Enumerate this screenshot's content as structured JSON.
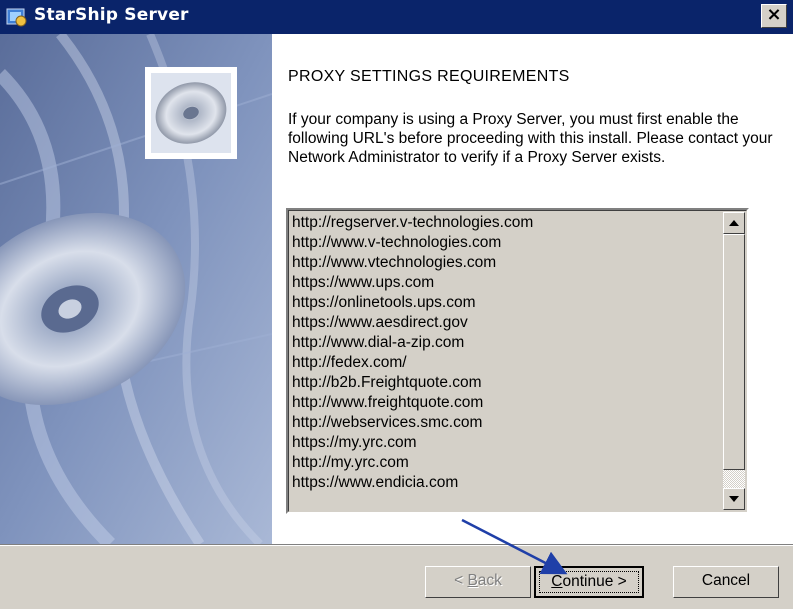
{
  "window": {
    "title": "StarShip Server",
    "close_glyph": "×",
    "icon": "starship-app-icon"
  },
  "content": {
    "heading": "PROXY SETTINGS REQUIREMENTS",
    "description": "If your company is using a Proxy Server, you must first enable the following URL's before proceeding with this install. Please contact your Network Administrator to verify if a Proxy Server exists.",
    "urls": [
      "http://regserver.v-technologies.com",
      "http://www.v-technologies.com",
      "http://www.vtechnologies.com",
      "https://www.ups.com",
      "https://onlinetools.ups.com",
      "https://www.aesdirect.gov",
      "http://www.dial-a-zip.com",
      "http://fedex.com/",
      "http://b2b.Freightquote.com",
      "http://www.freightquote.com",
      "http://webservices.smc.com",
      "https://my.yrc.com",
      "http://my.yrc.com",
      "https://www.endicia.com"
    ],
    "scrollbar": {
      "up_icon": "scroll-up-arrow-icon",
      "down_icon": "scroll-down-arrow-icon",
      "position": 1.0
    }
  },
  "footer": {
    "back_prefix": "< ",
    "back_accel": "B",
    "back_rest": "ack",
    "continue_accel": "C",
    "continue_rest": "ontinue >",
    "cancel_label": "Cancel"
  },
  "annotation": {
    "arrow_color": "#1f3fa8"
  }
}
